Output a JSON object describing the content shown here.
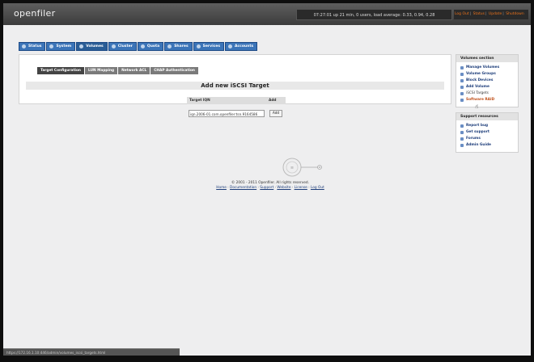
{
  "header": {
    "logo": "openfiler",
    "uptime": "07:27:01 up 21 min, 0 users, load average: 0.33, 0.94, 0.28",
    "links": [
      "Log Out",
      "Status",
      "Update",
      "Shutdown"
    ]
  },
  "nav": {
    "tabs": [
      {
        "label": "Status",
        "icon": "status-icon"
      },
      {
        "label": "System",
        "icon": "system-icon"
      },
      {
        "label": "Volumes",
        "icon": "volumes-icon"
      },
      {
        "label": "Cluster",
        "icon": "cluster-icon"
      },
      {
        "label": "Quota",
        "icon": "quota-icon"
      },
      {
        "label": "Shares",
        "icon": "shares-icon"
      },
      {
        "label": "Services",
        "icon": "services-icon"
      },
      {
        "label": "Accounts",
        "icon": "accounts-icon"
      }
    ],
    "active": "Volumes"
  },
  "main": {
    "subtabs": [
      "Target Configuration",
      "LUN Mapping",
      "Network ACL",
      "CHAP Authentication"
    ],
    "active_subtab": "Target Configuration",
    "title": "Add new iSCSI Target",
    "form": {
      "col_iqn": "Target IQN",
      "col_add": "Add",
      "iqn_value": "iqn.2006-01.com.openfiler:tsn.9164586",
      "add_button": "Add"
    }
  },
  "sidebar": {
    "volumes": {
      "title": "Volumes section",
      "items": [
        "Manage Volumes",
        "Volume Groups",
        "Block Devices",
        "Add Volume",
        "iSCSI Targets",
        "Software RAID"
      ]
    },
    "support": {
      "title": "Support resources",
      "items": [
        "Report bug",
        "Get support",
        "Forums",
        "Admin Guide"
      ]
    }
  },
  "footer": {
    "copyright": "© 2001 - 2011 Openfiler. All rights reserved.",
    "links": [
      "Home",
      "Documentation",
      "Support",
      "Website",
      "License",
      "Log Out"
    ]
  },
  "statusbar": {
    "text": "https://172.16.1.10:446/admin/volumes_iscsi_targets.html"
  },
  "colors": {
    "tab_blue": "#3b74b8",
    "link_orange": "#e8701a",
    "link_blue": "#1d3d7a"
  }
}
